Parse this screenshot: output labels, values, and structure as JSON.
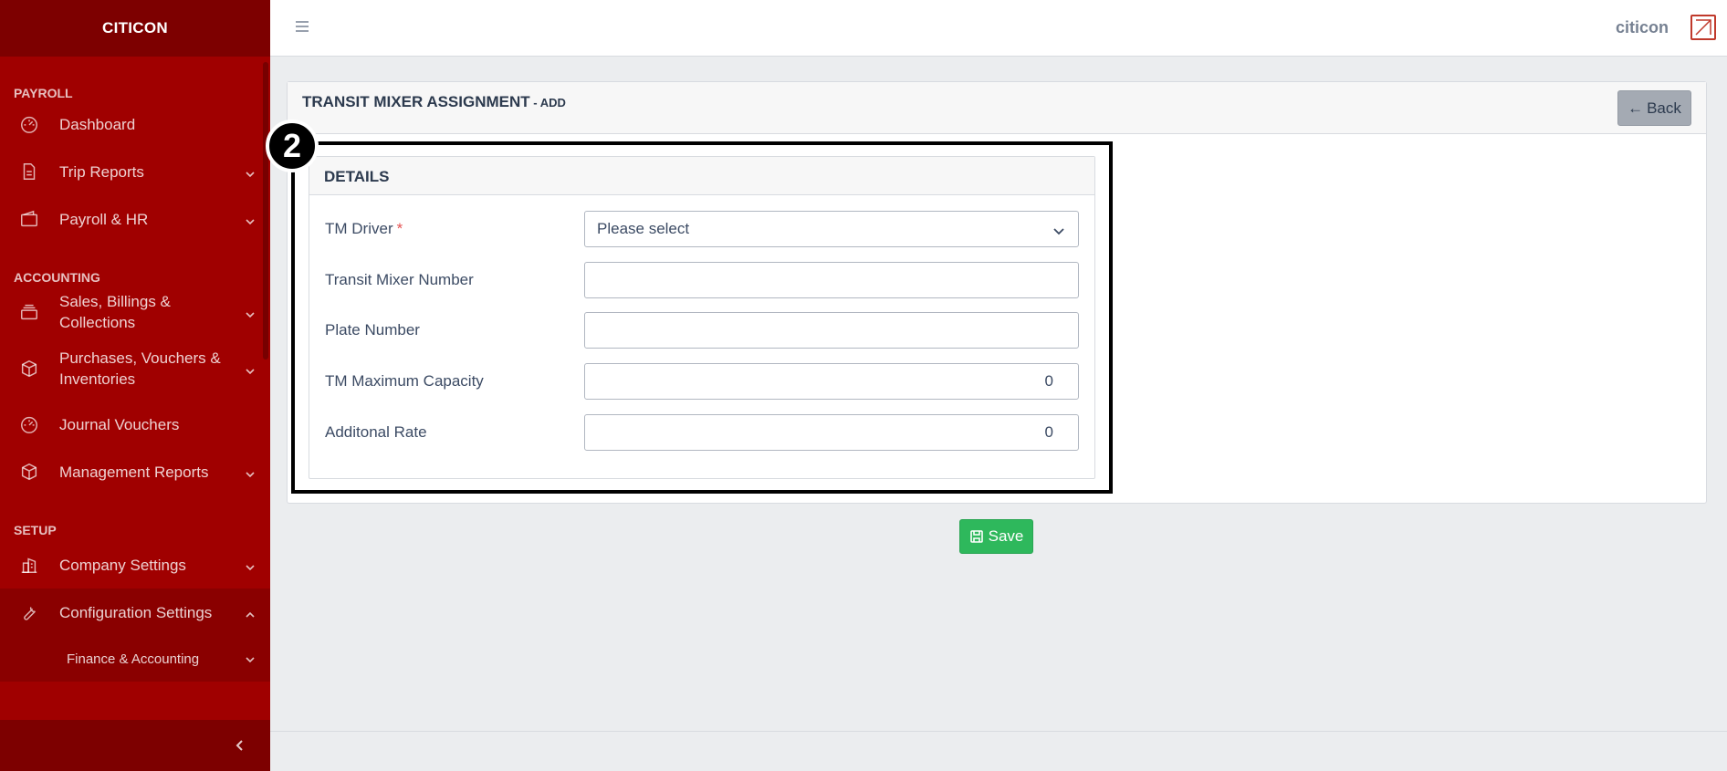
{
  "sidebar": {
    "brand": "CITICON",
    "sections": [
      {
        "title": "PAYROLL"
      },
      {
        "title": "ACCOUNTING"
      },
      {
        "title": "SETUP"
      }
    ],
    "items": [
      {
        "label": "Dashboard",
        "icon": "speedometer-icon"
      },
      {
        "label": "Trip Reports",
        "icon": "document-icon"
      },
      {
        "label": "Payroll & HR",
        "icon": "wallet-icon"
      },
      {
        "label": "Sales, Billings & Collections",
        "icon": "layers-icon"
      },
      {
        "label": "Purchases, Vouchers & Inventories",
        "icon": "cube-icon"
      },
      {
        "label": "Journal Vouchers",
        "icon": "speedometer-icon"
      },
      {
        "label": "Management Reports",
        "icon": "cube-icon"
      },
      {
        "label": "Company Settings",
        "icon": "building-icon"
      },
      {
        "label": "Configuration Settings",
        "icon": "wrench-icon"
      }
    ],
    "sub_items": [
      {
        "label": "Finance & Accounting"
      }
    ]
  },
  "header": {
    "user_name": "citicon"
  },
  "card": {
    "title": "TRANSIT MIXER ASSIGNMENT",
    "title_sub": " - ADD",
    "back_label": "Back"
  },
  "annotation": {
    "badge": "2"
  },
  "details": {
    "title": "DETAILS",
    "fields": [
      {
        "label": "TM Driver",
        "required_mark": "*",
        "value": "Please select"
      },
      {
        "label": "Transit Mixer Number",
        "value": ""
      },
      {
        "label": "Plate Number",
        "value": ""
      },
      {
        "label": "TM Maximum Capacity",
        "value": "0"
      },
      {
        "label": "Additonal Rate",
        "value": "0"
      }
    ]
  },
  "save_label": "Save",
  "colors": {
    "sidebar": "#a00000",
    "sidebar_dark": "#7d0000",
    "save": "#2eb85c",
    "back": "#a4aab3",
    "required": "#e55353"
  }
}
